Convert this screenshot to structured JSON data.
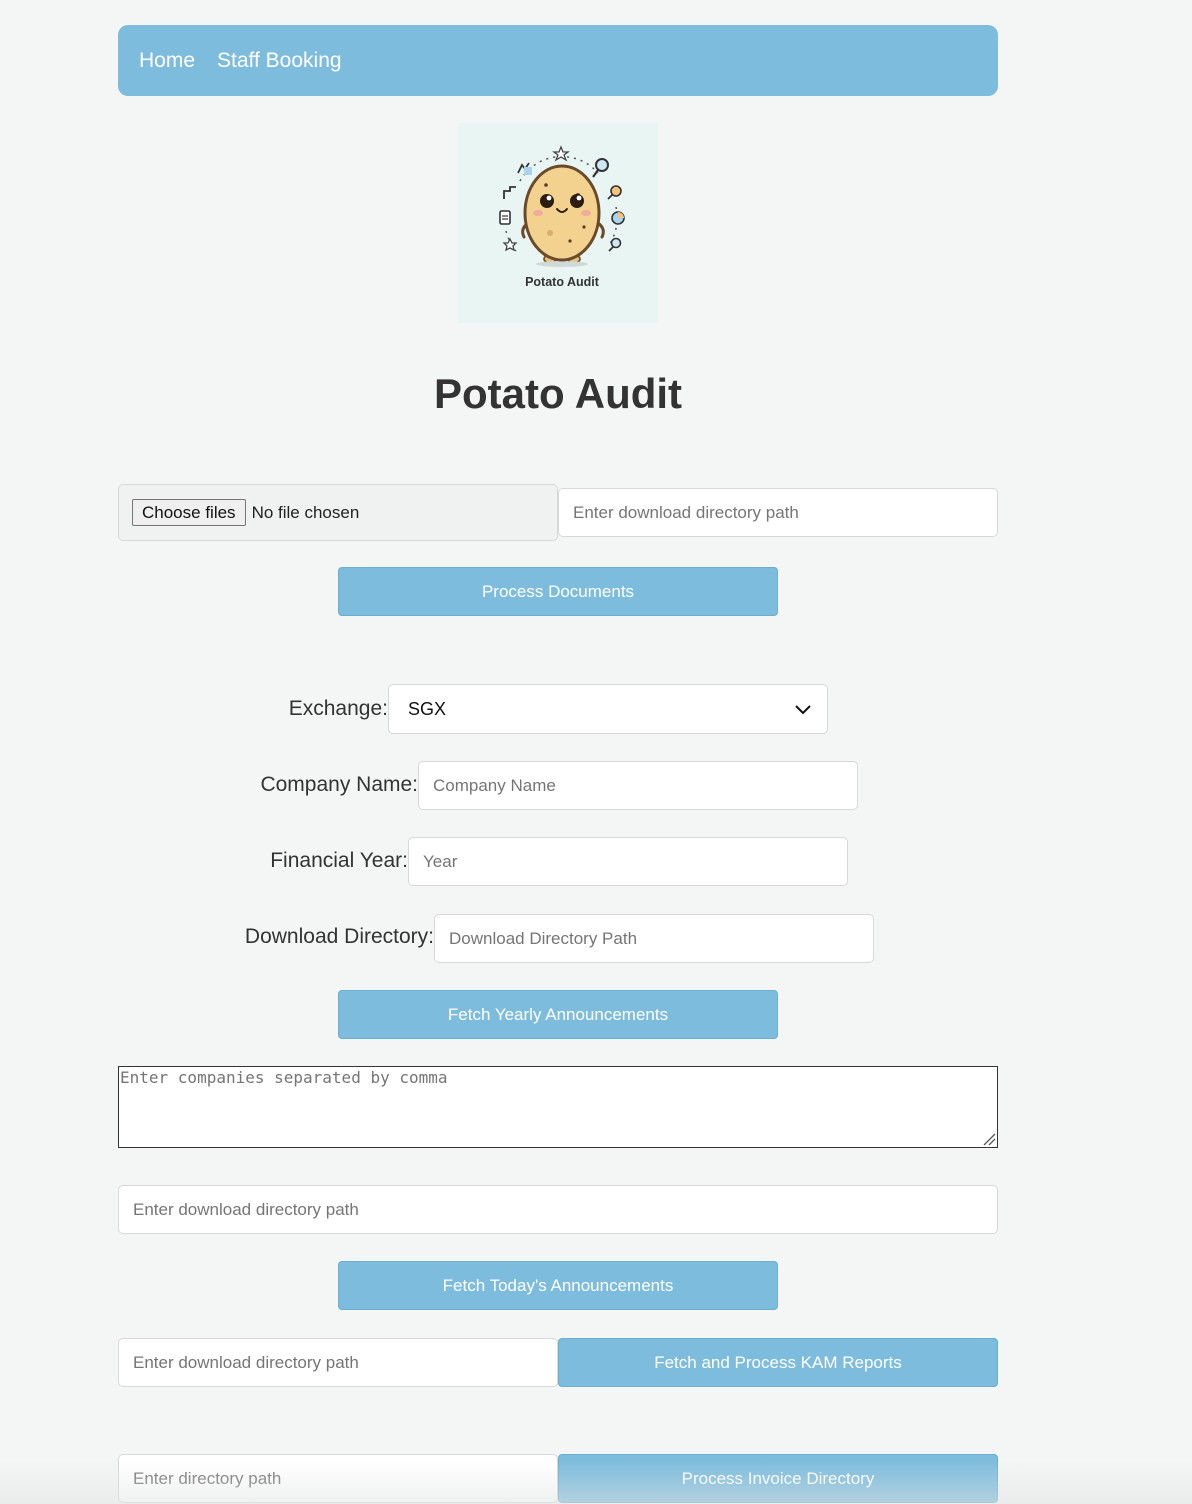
{
  "nav": {
    "home": "Home",
    "staff_booking": "Staff Booking"
  },
  "logo": {
    "caption": "Potato Audit"
  },
  "page_title": "Potato Audit",
  "process_section": {
    "choose_files_label": "Choose files",
    "file_status": "No file chosen",
    "download_dir_placeholder": "Enter download directory path",
    "process_button": "Process Documents"
  },
  "announcement_form": {
    "exchange_label": "Exchange:",
    "exchange_value": "SGX",
    "company_label": "Company Name:",
    "company_placeholder": "Company Name",
    "year_label": "Financial Year:",
    "year_placeholder": "Year",
    "download_label": "Download Directory:",
    "download_placeholder": "Download Directory Path",
    "fetch_yearly_button": "Fetch Yearly Announcements"
  },
  "today_section": {
    "companies_placeholder": "Enter companies separated by comma",
    "download_dir_placeholder": "Enter download directory path",
    "fetch_today_button": "Fetch Today's Announcements"
  },
  "kam_section": {
    "download_dir_placeholder": "Enter download directory path",
    "fetch_kam_button": "Fetch and Process KAM Reports"
  },
  "invoice_section": {
    "directory_placeholder": "Enter directory path",
    "process_invoice_button": "Process Invoice Directory"
  }
}
